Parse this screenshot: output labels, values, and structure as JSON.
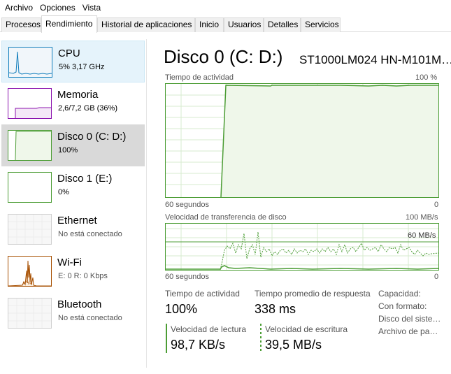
{
  "menu": [
    "Archivo",
    "Opciones",
    "Vista"
  ],
  "tabs": [
    "Procesos",
    "Rendimiento",
    "Historial de aplicaciones",
    "Inicio",
    "Usuarios",
    "Detalles",
    "Servicios"
  ],
  "active_tab": "Rendimiento",
  "sidebar": {
    "items": [
      {
        "title": "CPU",
        "subtitle": "5%  3,17 GHz",
        "state": "hover",
        "color": "#117dbb",
        "activity": 5
      },
      {
        "title": "Memoria",
        "subtitle": "2,6/7,2 GB (36%)",
        "state": "normal",
        "color": "#8b12ae",
        "activity": 36
      },
      {
        "title": "Disco 0 (C: D:)",
        "subtitle": "100%",
        "state": "selected",
        "color": "#4c9d35",
        "activity": 100
      },
      {
        "title": "Disco 1 (E:)",
        "subtitle": "0%",
        "state": "normal",
        "color": "#4c9d35",
        "activity": 0
      },
      {
        "title": "Ethernet",
        "subtitle": "No está conectado",
        "state": "disconnected",
        "color": "#c8c8c8"
      },
      {
        "title": "Wi-Fi",
        "subtitle": "E: 0 R: 0 Kbps",
        "state": "normal",
        "color": "#a74f01"
      },
      {
        "title": "Bluetooth",
        "subtitle": "No está conectado",
        "state": "disconnected",
        "color": "#c8c8c8"
      }
    ]
  },
  "main": {
    "title": "Disco 0 (C: D:)",
    "model": "ST1000LM024 HN-M101M…",
    "graph1": {
      "label": "Tiempo de actividad",
      "max_label": "100 %",
      "time_label": "60 segundos",
      "min_label": "0"
    },
    "graph2": {
      "label": "Velocidad de transferencia de disco",
      "max_label": "100 MB/s",
      "ref_label": "60 MB/s",
      "time_label": "60 segundos",
      "min_label": "0"
    },
    "stats": {
      "active_time_label": "Tiempo de actividad",
      "active_time_value": "100%",
      "avg_response_label": "Tiempo promedio de respuesta",
      "avg_response_value": "338 ms",
      "read_speed_label": "Velocidad de lectura",
      "read_speed_value": "98,7 KB/s",
      "write_speed_label": "Velocidad de escritura",
      "write_speed_value": "39,5 MB/s"
    },
    "properties": [
      "Capacidad:",
      "Con formato:",
      "Disco del siste…",
      "Archivo de pa…"
    ]
  },
  "colors": {
    "disk_green": "#4c9d35",
    "disk_fill": "#eff7ea",
    "grid": "#d7ebcf",
    "selected_bg": "#d9d9d9",
    "hover_bg": "#e5f3fb"
  }
}
